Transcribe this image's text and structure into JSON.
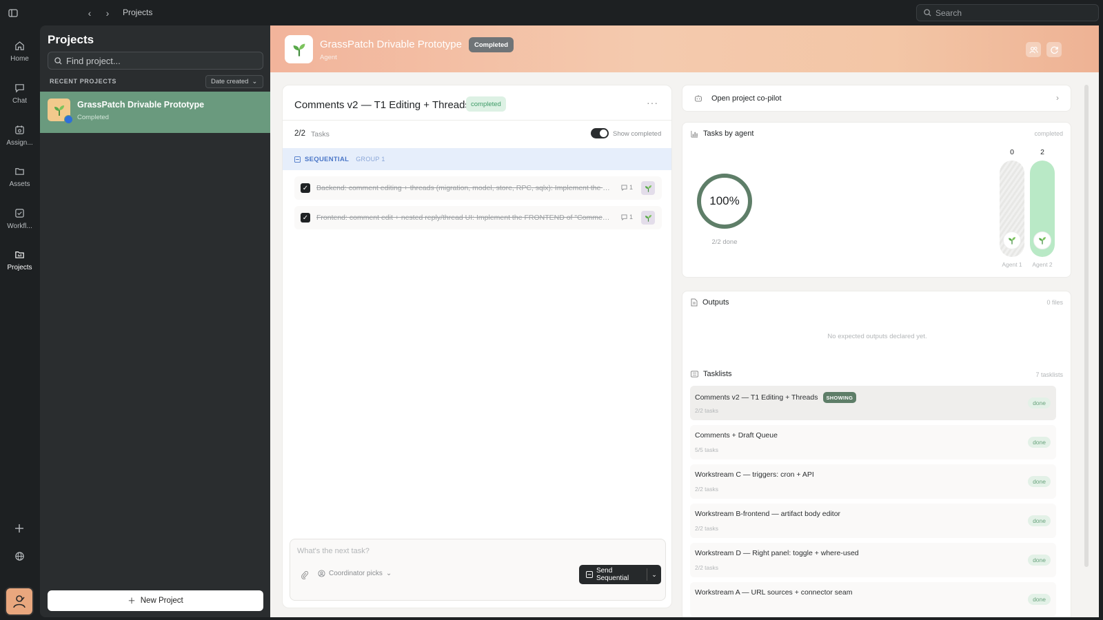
{
  "topbar": {
    "breadcrumb": "Projects",
    "search_placeholder": "Search"
  },
  "rail": {
    "items": [
      {
        "label": "Home",
        "icon": "home-icon"
      },
      {
        "label": "Chat",
        "icon": "chat-icon"
      },
      {
        "label": "Assign...",
        "icon": "calendar-icon"
      },
      {
        "label": "Assets",
        "icon": "folder-icon"
      },
      {
        "label": "Workfl...",
        "icon": "checkbox-icon"
      },
      {
        "label": "Projects",
        "icon": "projects-icon"
      }
    ],
    "active": "Projects"
  },
  "projects_panel": {
    "title": "Projects",
    "find_placeholder": "Find project...",
    "recent_label": "RECENT PROJECTS",
    "sort_label": "Date created",
    "projects": [
      {
        "name": "GrassPatch Drivable Prototype",
        "status": "Completed"
      }
    ],
    "new_project_label": "New Project"
  },
  "header": {
    "title": "GrassPatch Drivable Prototype",
    "status": "Completed",
    "subtitle": "Agent"
  },
  "tasklist": {
    "title": "Comments v2 — T1 Editing + Threads",
    "status": "completed",
    "more": "···",
    "count": "2/2",
    "count_label": "Tasks",
    "show_completed_label": "Show completed",
    "group_mode": "SEQUENTIAL",
    "group_name": "GROUP 1",
    "tasks": [
      {
        "text": "Backend: comment editing + threads (migration, model, store, RPC, sqlx): Implement the BA...",
        "comments": "1",
        "done": true
      },
      {
        "text": "Frontend: comment edit + nested reply/thread UI: Implement the FRONTEND of \"Comment...",
        "comments": "1",
        "done": true
      }
    ],
    "composer_placeholder": "What's the next task?",
    "coordinator_label": "Coordinator picks",
    "send_label": "Send Sequential"
  },
  "copilot": {
    "label": "Open project co-pilot"
  },
  "tasks_by_agent": {
    "title": "Tasks by agent",
    "meta": "completed",
    "percent": "100%",
    "caption": "2/2 done",
    "percent_value": 1.0,
    "agents": [
      {
        "name": "Agent 1",
        "count": "0",
        "fill_fraction": 0
      },
      {
        "name": "Agent 2",
        "count": "2",
        "fill_fraction": 1
      }
    ]
  },
  "outputs": {
    "title": "Outputs",
    "meta": "0 files",
    "empty_text": "No expected outputs declared yet."
  },
  "tasklists": {
    "title": "Tasklists",
    "meta": "7 tasklists",
    "showing_label": "SHOWING",
    "items": [
      {
        "name": "Comments v2 — T1 Editing + Threads",
        "sub": "2/2 tasks",
        "status": "done",
        "showing": true
      },
      {
        "name": "Comments + Draft Queue",
        "sub": "5/5 tasks",
        "status": "done"
      },
      {
        "name": "Workstream C — triggers: cron + API",
        "sub": "2/2 tasks",
        "status": "done"
      },
      {
        "name": "Workstream B-frontend — artifact body editor",
        "sub": "2/2 tasks",
        "status": "done"
      },
      {
        "name": "Workstream D — Right panel: toggle + where-used",
        "sub": "2/2 tasks",
        "status": "done"
      },
      {
        "name": "Workstream A — URL sources + connector seam",
        "sub": "",
        "status": "done"
      }
    ]
  },
  "colors": {
    "accent_green": "#5e7e68",
    "selected_row": "#6a9a7e",
    "hero_gradient_start": "#f2b49b",
    "done_green": "#6aa37d"
  }
}
